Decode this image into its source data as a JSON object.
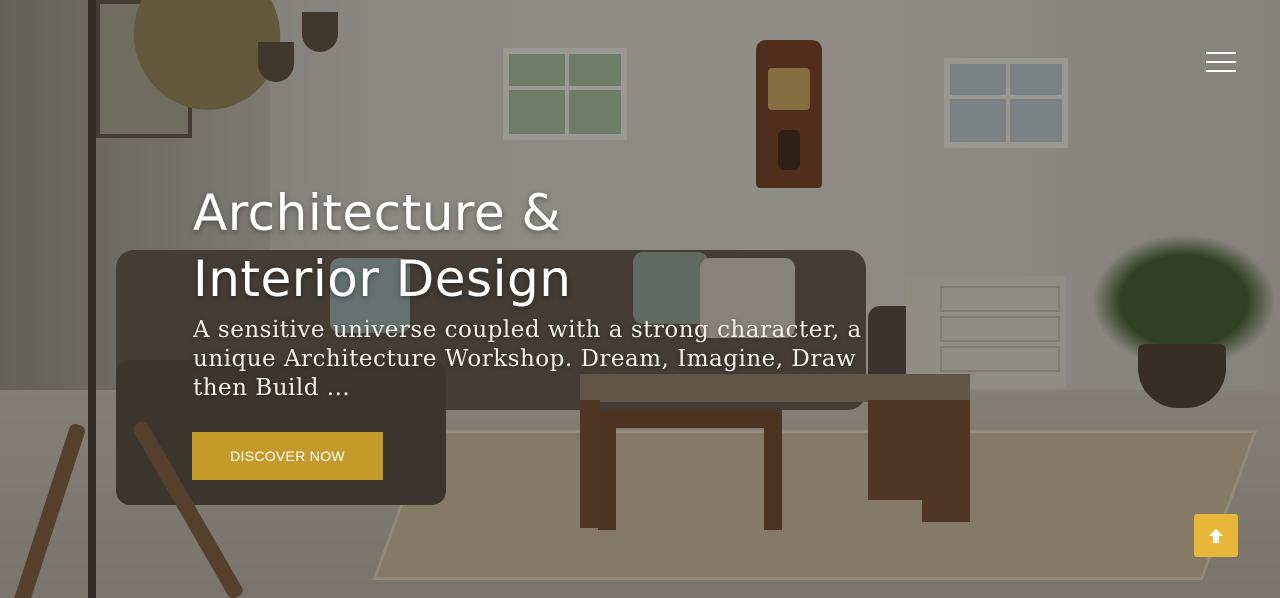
{
  "hero": {
    "title_line1": "Architecture &",
    "title_line2": "Interior Design",
    "subtitle": "A sensitive universe coupled with a strong character, a unique Architecture Workshop. Dream, Imagine, Draw then Build ...",
    "cta_label": "DISCOVER NOW",
    "background_image": "living-room-photo"
  },
  "nav": {
    "menu_icon": "hamburger-icon"
  },
  "controls": {
    "back_to_top_icon": "arrow-up-icon"
  },
  "colors": {
    "accent": "#c49a2b",
    "back_to_top": "#e8b63a",
    "text": "#ffffff"
  }
}
